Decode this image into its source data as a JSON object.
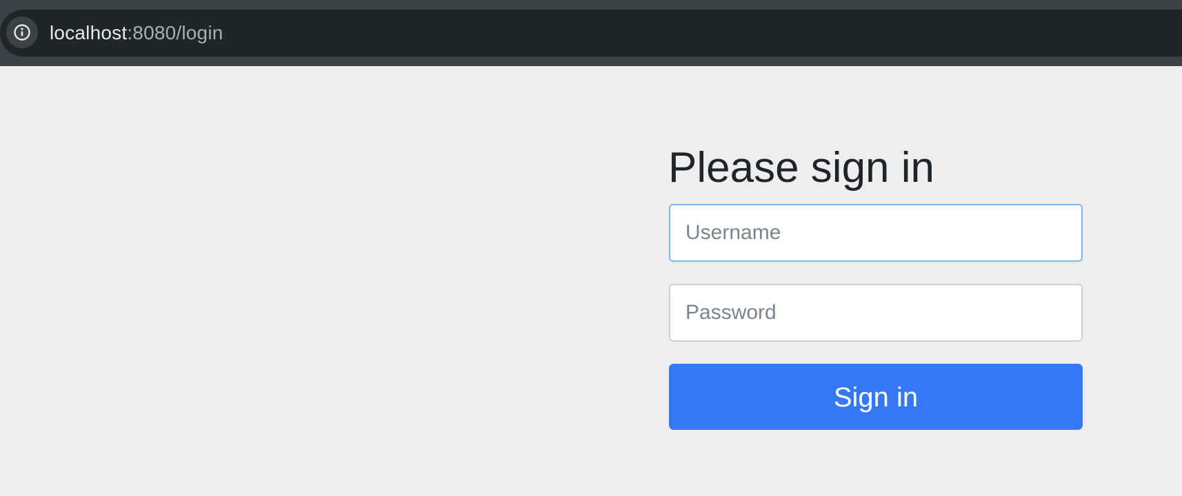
{
  "browser": {
    "url_host": "localhost",
    "url_rest": ":8080/login",
    "info_icon": "info-circle-icon"
  },
  "login": {
    "title": "Please sign in",
    "username": {
      "value": "",
      "placeholder": "Username"
    },
    "password": {
      "value": "",
      "placeholder": "Password"
    },
    "submit_label": "Sign in"
  },
  "colors": {
    "accent": "#3578f6",
    "page_background": "#eeeeee",
    "browser_chrome": "#1f2628",
    "focus_border": "#80b4f6"
  }
}
